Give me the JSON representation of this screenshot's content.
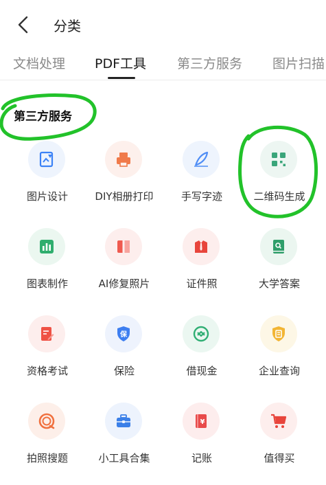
{
  "header": {
    "title": "分类"
  },
  "tabs": [
    {
      "label": "文档处理"
    },
    {
      "label": "PDF工具"
    },
    {
      "label": "第三方服务"
    },
    {
      "label": "图片扫描"
    }
  ],
  "section": {
    "title": "第三方服务"
  },
  "items": [
    {
      "label": "图片设计",
      "icon": "image-design-icon",
      "color": "#3b82f6"
    },
    {
      "label": "DIY相册打印",
      "icon": "photo-print-icon",
      "color": "#f07a4a"
    },
    {
      "label": "手写字迹",
      "icon": "feather-pen-icon",
      "color": "#4f8df5"
    },
    {
      "label": "二维码生成",
      "icon": "qr-code-icon",
      "color": "#3aa57a"
    },
    {
      "label": "图表制作",
      "icon": "bar-chart-icon",
      "color": "#2fae6e"
    },
    {
      "label": "AI修复照片",
      "icon": "ai-photo-repair-icon",
      "color": "#ef5a4f"
    },
    {
      "label": "证件照",
      "icon": "id-photo-icon",
      "color": "#e8453c"
    },
    {
      "label": "大学答案",
      "icon": "book-icon",
      "color": "#2f9e6a"
    },
    {
      "label": "资格考试",
      "icon": "exam-doc-icon",
      "color": "#ef5245"
    },
    {
      "label": "保险",
      "icon": "insurance-shield-icon",
      "color": "#3d7ef0"
    },
    {
      "label": "借现金",
      "icon": "cash-loan-icon",
      "color": "#2fae73"
    },
    {
      "label": "企业查询",
      "icon": "company-query-icon",
      "color": "#f2b534"
    },
    {
      "label": "拍照搜题",
      "icon": "photo-search-icon",
      "color": "#f0713f"
    },
    {
      "label": "小工具合集",
      "icon": "toolbox-icon",
      "color": "#3a7fe8"
    },
    {
      "label": "记账",
      "icon": "bookkeeping-icon",
      "color": "#e84a4a"
    },
    {
      "label": "值得买",
      "icon": "shopping-cart-icon",
      "color": "#e8453c"
    }
  ]
}
